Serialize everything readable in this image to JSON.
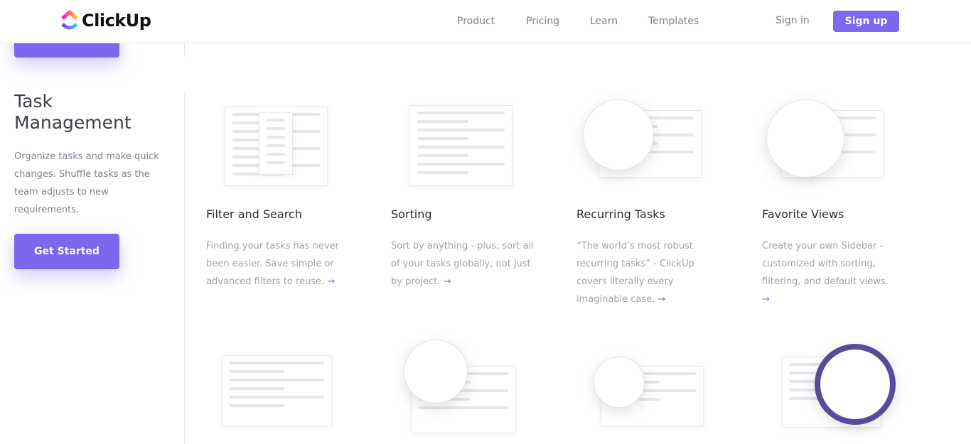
{
  "header": {
    "logo": "ClickUp",
    "nav": [
      "Product",
      "Pricing",
      "Learn",
      "Templates"
    ],
    "sign_in": "Sign in",
    "sign_up": "Sign up"
  },
  "section": {
    "title_line1": "Task",
    "title_line2": "Management",
    "description": "Organize tasks and make quick changes. Shuffle tasks as the team adjusts to new requirements.",
    "cta": "Get Started"
  },
  "features": [
    {
      "title": "Filter and Search",
      "description": "Finding your tasks has never been easier. Save simple or advanced filters to reuse."
    },
    {
      "title": "Sorting",
      "description": "Sort by anything - plus, sort all of your tasks globally, not just by project."
    },
    {
      "title": "Recurring Tasks",
      "description": "“The world’s most robust recurring tasks” - ClickUp covers literally every imaginable case."
    },
    {
      "title": "Favorite Views",
      "description": "Create your own Sidebar - customized with sorting, filtering, and default views."
    }
  ],
  "colors": {
    "accent": "#7b68ee"
  },
  "icons": {
    "link_arrow": "arrow-right-icon"
  }
}
